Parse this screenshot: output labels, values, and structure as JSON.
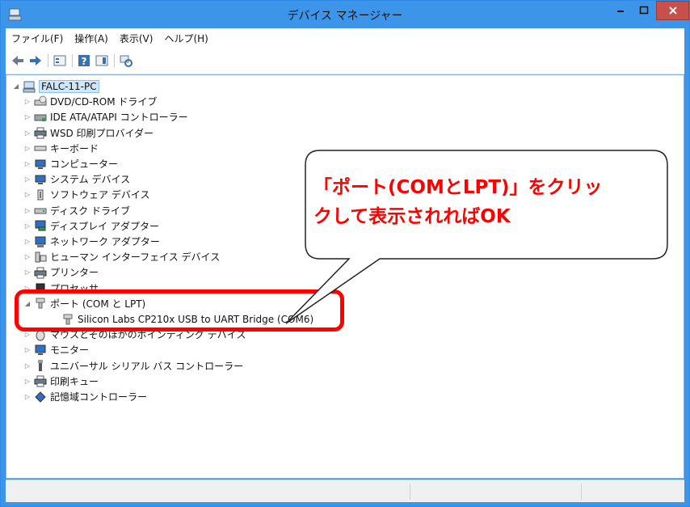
{
  "window": {
    "title": "デバイス マネージャー"
  },
  "menu": [
    "ファイル(F)",
    "操作(A)",
    "表示(V)",
    "ヘルプ(H)"
  ],
  "toolbar": [
    "back-icon",
    "forward-icon",
    "properties-icon",
    "help-icon",
    "view-icon",
    "scan-hardware-icon"
  ],
  "tree": {
    "root": "FALC-11-PC",
    "items": [
      {
        "label": "DVD/CD-ROM ドライブ",
        "icon": "dvd-drive-icon"
      },
      {
        "label": "IDE ATA/ATAPI コントローラー",
        "icon": "ide-controller-icon"
      },
      {
        "label": "WSD 印刷プロバイダー",
        "icon": "printer-icon"
      },
      {
        "label": "キーボード",
        "icon": "keyboard-icon"
      },
      {
        "label": "コンピューター",
        "icon": "computer-icon"
      },
      {
        "label": "システム デバイス",
        "icon": "system-device-icon"
      },
      {
        "label": "ソフトウェア デバイス",
        "icon": "software-device-icon"
      },
      {
        "label": "ディスク ドライブ",
        "icon": "disk-drive-icon"
      },
      {
        "label": "ディスプレイ アダプター",
        "icon": "display-adapter-icon"
      },
      {
        "label": "ネットワーク アダプター",
        "icon": "network-adapter-icon"
      },
      {
        "label": "ヒューマン インターフェイス デバイス",
        "icon": "hid-icon"
      },
      {
        "label": "プリンター",
        "icon": "printer-icon"
      },
      {
        "label": "プロセッサ",
        "icon": "processor-icon"
      },
      {
        "label": "ポート (COM と LPT)",
        "icon": "port-icon",
        "expanded": true
      },
      {
        "label": "Silicon Labs CP210x USB to UART Bridge (COM6)",
        "icon": "port-icon",
        "child": true
      },
      {
        "label": "マウスとそのほかのポインティング デバイス",
        "icon": "mouse-icon"
      },
      {
        "label": "モニター",
        "icon": "monitor-icon"
      },
      {
        "label": "ユニバーサル シリアル バス コントローラー",
        "icon": "usb-icon"
      },
      {
        "label": "印刷キュー",
        "icon": "print-queue-icon"
      },
      {
        "label": "記憶域コントローラー",
        "icon": "storage-controller-icon"
      }
    ]
  },
  "callout": {
    "line1": "「ポート(COMとLPT)」をクリッ",
    "line2": "クして表示されればOK",
    "color": "#ff0000"
  },
  "colors": {
    "titlebar": "#3c95e8",
    "close": "#c7504a",
    "highlight": "#ff0000"
  }
}
